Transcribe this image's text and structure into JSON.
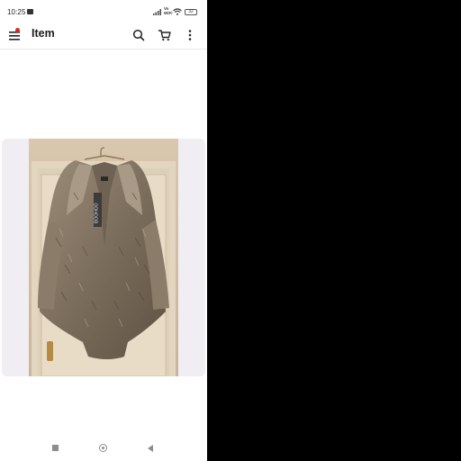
{
  "status_bar": {
    "time": "10:25",
    "volte": "Vo\nWiFi",
    "battery": "32"
  },
  "app_bar": {
    "title": "Item"
  },
  "icons": [
    "sim-icon",
    "signal-icon",
    "wifi-icon",
    "battery-icon",
    "menu-icon",
    "search-icon",
    "cart-icon",
    "more-icon",
    "nav-recents-icon",
    "nav-home-icon",
    "nav-back-icon"
  ],
  "colors": {
    "accent": "#e4261c",
    "card_bg": "#f1eef3",
    "background": "#ffffff",
    "outer": "#000000"
  },
  "photo": {
    "tag_text": "BOOHOO"
  }
}
